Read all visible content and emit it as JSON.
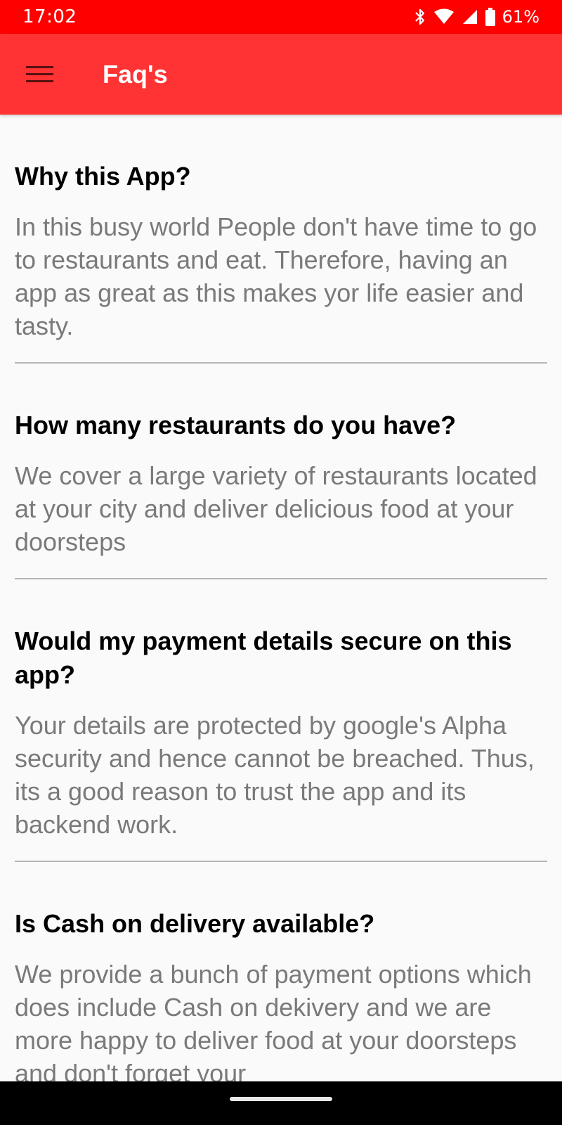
{
  "status_bar": {
    "time": "17:02",
    "battery_percent": "61%",
    "icons": [
      "bluetooth-icon",
      "wifi-icon",
      "cell-signal-icon",
      "battery-icon"
    ],
    "background_color": "#ff0000"
  },
  "app_bar": {
    "title": "Faq's",
    "menu_icon": "hamburger-menu-icon",
    "background_color": "#ff3333"
  },
  "faqs": [
    {
      "question": "Why this App?",
      "answer": "In this busy world People don't have time to go to restaurants and eat. Therefore, having an app as great as this makes yor life easier and tasty."
    },
    {
      "question": "How many restaurants do you have?",
      "answer": "We cover a large variety of restaurants located at your city and deliver delicious food at your doorsteps"
    },
    {
      "question": "Would my payment details secure on this app?",
      "answer": "Your details are protected by google's Alpha security and hence cannot be breached. Thus, its a good reason to trust the app and its backend work."
    },
    {
      "question": "Is Cash on delivery available?",
      "answer": "We provide a bunch of payment options which does include Cash on dekivery and we are more happy to deliver food at your doorsteps and don't forget your"
    }
  ]
}
